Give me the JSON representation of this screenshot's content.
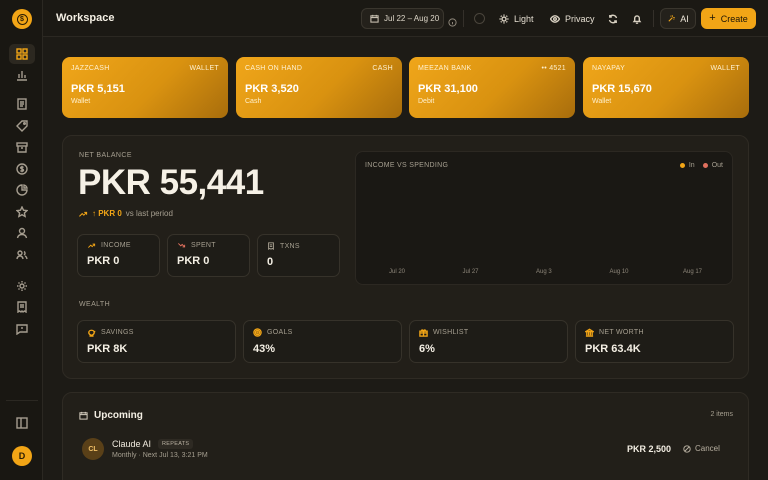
{
  "header": {
    "title": "Workspace",
    "date_range": "Jul 22 – Aug 20",
    "theme_label": "Light",
    "privacy_label": "Privacy",
    "ai_label": "AI",
    "create_label": "Create"
  },
  "sidebar": {
    "avatar_initial": "D",
    "icons": [
      "dashboard-icon",
      "chart-icon",
      "document-icon",
      "tag-icon",
      "archive-icon",
      "dollar-icon",
      "pie-icon",
      "star-icon",
      "user-icon",
      "users-icon",
      "settings-icon",
      "receipt-icon",
      "message-icon",
      "collapse-sidebar-icon"
    ]
  },
  "wallets": [
    {
      "name": "JAZZCASH",
      "kind": "WALLET",
      "amount": "PKR 5,151",
      "type": "Wallet"
    },
    {
      "name": "CASH ON HAND",
      "kind": "CASH",
      "amount": "PKR 3,520",
      "type": "Cash"
    },
    {
      "name": "MEEZAN BANK",
      "kind": "•• 4521",
      "amount": "PKR 31,100",
      "type": "Debit"
    },
    {
      "name": "NAYAPAY",
      "kind": "WALLET",
      "amount": "PKR 15,670",
      "type": "Wallet"
    }
  ],
  "net_balance": {
    "label": "NET BALANCE",
    "amount": "PKR 55,441",
    "change": "↑ PKR 0",
    "change_suffix": "vs last period"
  },
  "stats": [
    {
      "label": "INCOME",
      "value": "PKR 0",
      "color": "#f2a516"
    },
    {
      "label": "SPENT",
      "value": "PKR 0",
      "color": "#e0705e"
    },
    {
      "label": "TXNS",
      "value": "0",
      "color": "#a69f90"
    }
  ],
  "chart": {
    "title": "INCOME VS SPENDING",
    "legend": [
      {
        "name": "In",
        "color": "#f2a516"
      },
      {
        "name": "Out",
        "color": "#e0705e"
      }
    ]
  },
  "chart_data": {
    "type": "area",
    "title": "INCOME VS SPENDING",
    "x": [
      "Jul 20",
      "Jul 27",
      "Aug 3",
      "Aug 10",
      "Aug 17"
    ],
    "series": [
      {
        "name": "In",
        "values": [
          0,
          0,
          0,
          0,
          0
        ]
      },
      {
        "name": "Out",
        "values": [
          0,
          0,
          0,
          0,
          0
        ]
      }
    ],
    "legend": "top-right",
    "grid": false
  },
  "wealth": {
    "label": "WEALTH",
    "items": [
      {
        "label": "SAVINGS",
        "value": "PKR 8K",
        "icon": "piggy-bank-icon"
      },
      {
        "label": "GOALS",
        "value": "43%",
        "icon": "target-icon"
      },
      {
        "label": "WISHLIST",
        "value": "6%",
        "icon": "gift-icon"
      },
      {
        "label": "NET WORTH",
        "value": "PKR 63.4K",
        "icon": "bank-icon"
      }
    ]
  },
  "upcoming": {
    "title": "Upcoming",
    "count": "2 items",
    "items": [
      {
        "initials": "CL",
        "name": "Claude AI",
        "badge": "REPEATS",
        "sub": "Monthly · Next Jul 13, 3:21 PM",
        "amount": "PKR 2,500",
        "action": "Cancel"
      }
    ]
  }
}
